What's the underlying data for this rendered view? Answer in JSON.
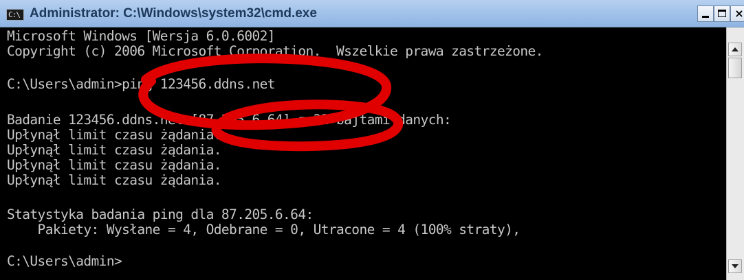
{
  "window": {
    "icon_text": "C:\\",
    "title": "Administrator: C:\\Windows\\system32\\cmd.exe",
    "min_label": "",
    "max_label": "",
    "close_label": "×"
  },
  "console": {
    "lines": [
      "Microsoft Windows [Wersja 6.0.6002]",
      "Copyright (c) 2006 Microsoft Corporation.  Wszelkie prawa zastrzeżone.",
      "",
      "C:\\Users\\admin>ping 123456.ddns.net",
      "",
      "Badanie 123456.ddns.net [87.205.6.64] z 32 bajtami danych:",
      "Upłynął limit czasu żądania.",
      "Upłynął limit czasu żądania.",
      "Upłynął limit czasu żądania.",
      "Upłynął limit czasu żądania.",
      "",
      "Statystyka badania ping dla 87.205.6.64:",
      "    Pakiety: Wysłane = 4, Odebrane = 0, Utracone = 4 (100% straty),",
      "",
      "C:\\Users\\admin>"
    ]
  },
  "annotations": {
    "ellipse_color": "#e00000"
  }
}
